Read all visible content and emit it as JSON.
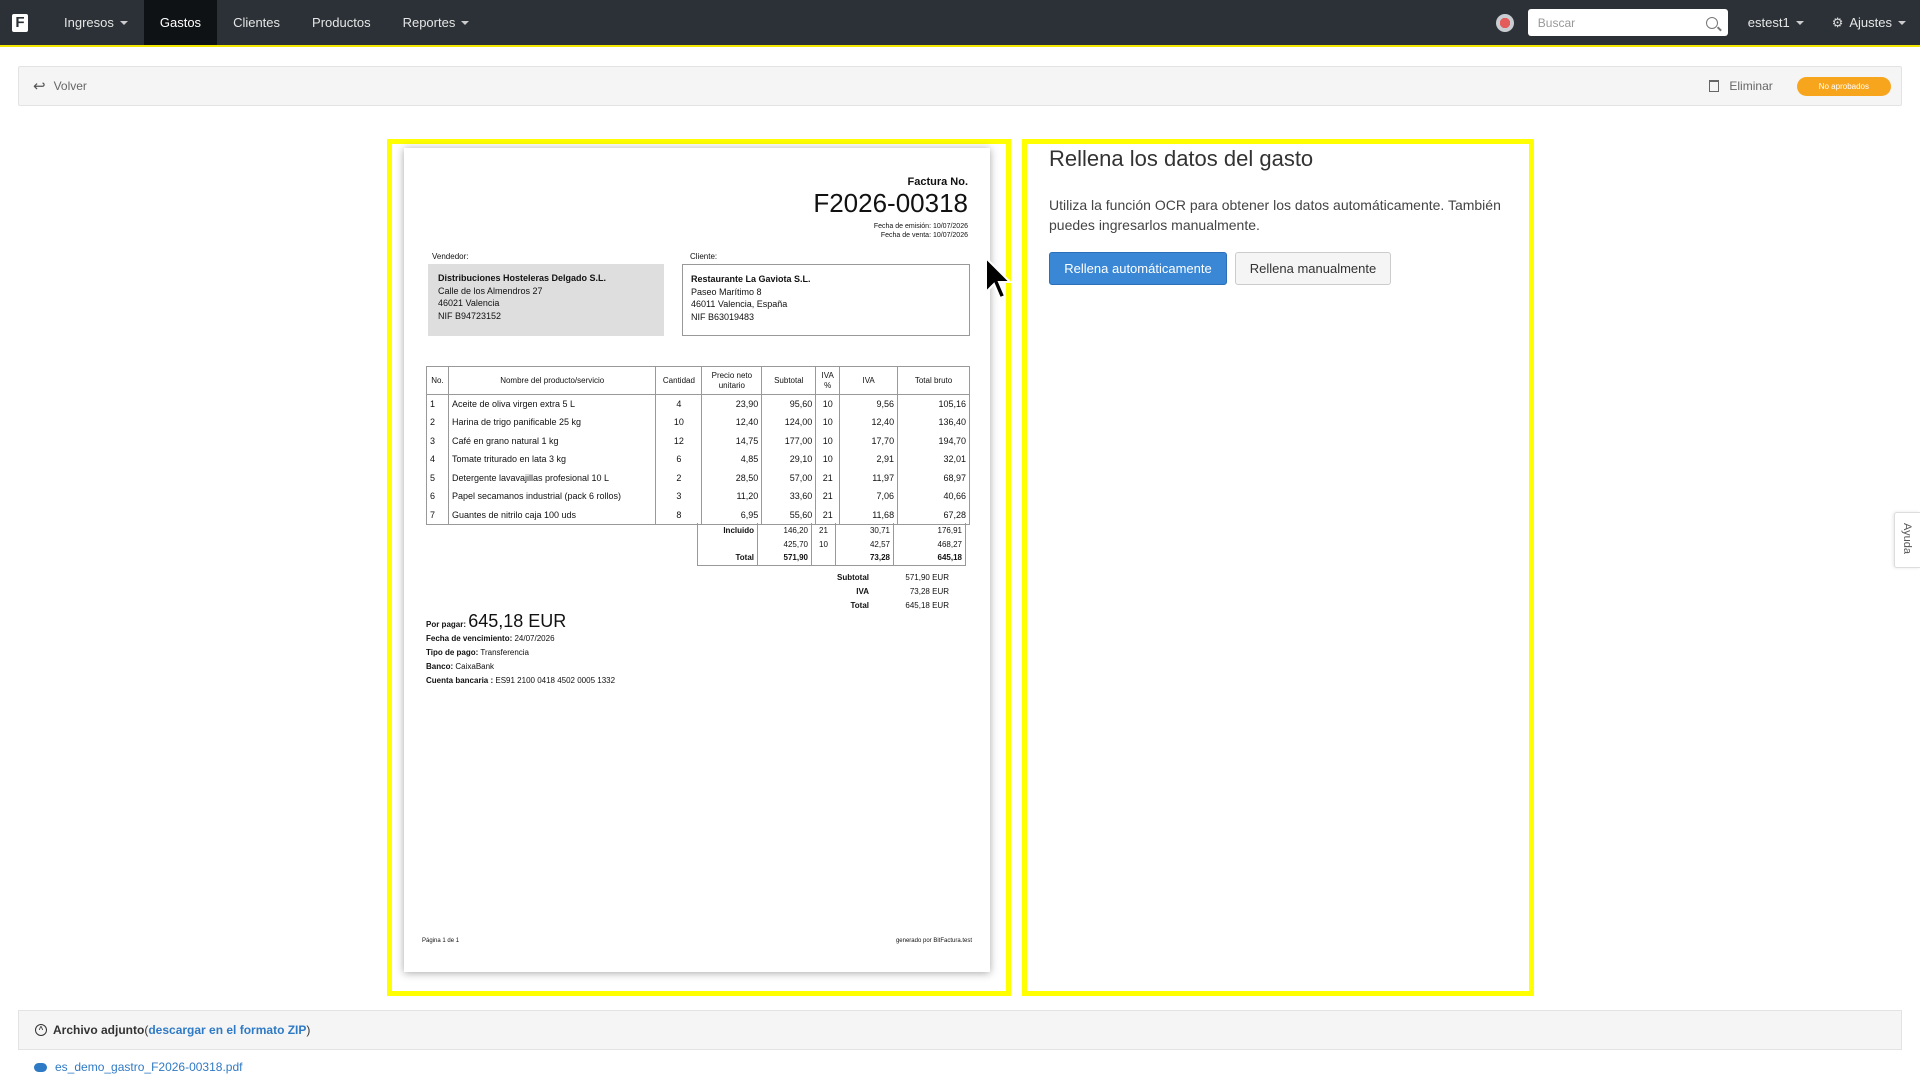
{
  "nav": {
    "logo": "F",
    "items": [
      {
        "label": "Ingresos",
        "dropdown": true,
        "active": false
      },
      {
        "label": "Gastos",
        "dropdown": false,
        "active": true
      },
      {
        "label": "Clientes",
        "dropdown": false,
        "active": false
      },
      {
        "label": "Productos",
        "dropdown": false,
        "active": false
      },
      {
        "label": "Reportes",
        "dropdown": true,
        "active": false
      }
    ],
    "search_placeholder": "Buscar",
    "user": "estest1",
    "settings": "Ajustes"
  },
  "toolbar": {
    "back_label": "Volver",
    "delete_label": "Eliminar",
    "status_badge": "No aprobados",
    "badge_color": "#f7a51d"
  },
  "invoice": {
    "title_label": "Factura No.",
    "number": "F2026-00318",
    "issue_date": "Fecha de emisión: 10/07/2026",
    "sale_date": "Fecha de venta: 10/07/2026",
    "vendor_label": "Vendedor:",
    "vendor": {
      "name": "Distribuciones Hosteleras Delgado S.L.",
      "line1": "Calle de los Almendros 27",
      "line2": "46021 Valencia",
      "line3": "NIF B94723152"
    },
    "client_label": "Cliente:",
    "client": {
      "name": "Restaurante La Gaviota S.L.",
      "line1": "Paseo Marítimo 8",
      "line2": "46011 Valencia, España",
      "line3": "NIF B63019483"
    },
    "columns": [
      "No.",
      "Nombre del producto/servicio",
      "Cantidad",
      "Precio neto unitario",
      "Subtotal",
      "IVA %",
      "IVA",
      "Total bruto"
    ],
    "rows": [
      [
        "1",
        "Aceite de oliva virgen extra 5 L",
        "4",
        "23,90",
        "95,60",
        "10",
        "9,56",
        "105,16"
      ],
      [
        "2",
        "Harina de trigo panificable 25 kg",
        "10",
        "12,40",
        "124,00",
        "10",
        "12,40",
        "136,40"
      ],
      [
        "3",
        "Café en grano natural 1 kg",
        "12",
        "14,75",
        "177,00",
        "10",
        "17,70",
        "194,70"
      ],
      [
        "4",
        "Tomate triturado en lata 3 kg",
        "6",
        "4,85",
        "29,10",
        "10",
        "2,91",
        "32,01"
      ],
      [
        "5",
        "Detergente lavavajillas profesional 10 L",
        "2",
        "28,50",
        "57,00",
        "21",
        "11,97",
        "68,97"
      ],
      [
        "6",
        "Papel secamanos industrial (pack 6 rollos)",
        "3",
        "11,20",
        "33,60",
        "21",
        "7,06",
        "40,66"
      ],
      [
        "7",
        "Guantes de nitrilo caja 100 uds",
        "8",
        "6,95",
        "55,60",
        "21",
        "11,68",
        "67,28"
      ]
    ],
    "summary": [
      [
        "Incluido",
        "146,20",
        "21",
        "30,71",
        "176,91"
      ],
      [
        "",
        "425,70",
        "10",
        "42,57",
        "468,27"
      ],
      [
        "Total",
        "571,90",
        "",
        "73,28",
        "645,18"
      ]
    ],
    "grand": [
      [
        "Subtotal",
        "571,90 EUR"
      ],
      [
        "IVA",
        "73,28 EUR"
      ],
      [
        "Total",
        "645,18 EUR"
      ]
    ],
    "pay_label": "Por pagar:",
    "pay_amount": "645,18 EUR",
    "due_label": "Fecha de vencimiento:",
    "due_value": "24/07/2026",
    "paytype_label": "Tipo de pago:",
    "paytype_value": "Transferencia",
    "bank_label": "Banco:",
    "bank_value": "CaixaBank",
    "account_label": "Cuenta bancaria :",
    "account_value": "ES91 2100 0418 4502 0005 1332",
    "footer_left": "Página 1 de 1",
    "footer_right": "generado por BitFactura.test"
  },
  "form": {
    "title": "Rellena los datos del gasto",
    "description": "Utiliza la función OCR para obtener los datos automáticamente. También puedes ingresarlos manualmente.",
    "auto_button": "Rellena automáticamente",
    "manual_button": "Rellena manualmente"
  },
  "help_tab": "Ayuda",
  "attachment": {
    "title": "Archivo adjunto",
    "open_paren": " (",
    "zip_link": "descargar en el formato ZIP",
    "close_paren": ")",
    "file_name": "es_demo_gastro_F2026-00318.pdf"
  },
  "highlight_color": "#ffff00"
}
